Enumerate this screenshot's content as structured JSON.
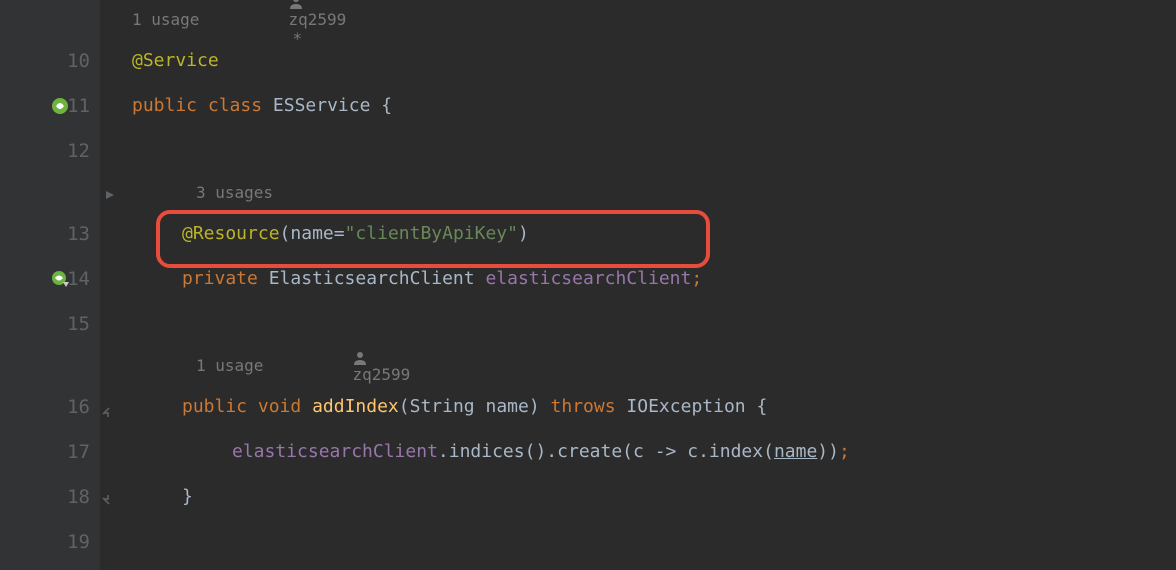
{
  "lines": {
    "l9": {
      "usages": "1 usage",
      "author": "zq2599",
      "star": "*"
    },
    "l10": {
      "annotation": "@Service"
    },
    "l11": {
      "public": "public",
      "class": "class",
      "name": "ESService",
      "brace": "{"
    },
    "l12_gap": {
      "usages": "3 usages"
    },
    "l13": {
      "annotation": "@Resource",
      "lparen": "(",
      "attr": "name",
      "eq": "=",
      "string": "\"clientByApiKey\"",
      "rparen": ")"
    },
    "l14": {
      "private": "private",
      "type": "ElasticsearchClient",
      "var": "elasticsearchClient",
      "semi": ";"
    },
    "l15_gap": {
      "usages": "1 usage",
      "author": "zq2599"
    },
    "l16": {
      "public": "public",
      "void": "void",
      "method": "addIndex",
      "lparen": "(",
      "ptype": "String",
      "pname": "name",
      "rparen": ")",
      "throws": "throws",
      "exc": "IOException",
      "brace": "{"
    },
    "l17": {
      "var": "elasticsearchClient",
      "dot1": ".",
      "m1": "indices",
      "p1": "()",
      "dot2": ".",
      "m2": "create",
      "lparen": "(",
      "lambda_p": "c",
      "arrow": " -> ",
      "lambda_v": "c",
      "dot3": ".",
      "m3": "index",
      "lparen2": "(",
      "arg": "name",
      "rparen2": ")",
      "rparen": ")",
      "semi": ";"
    },
    "l18": {
      "brace": "}"
    }
  },
  "numbers": {
    "n10": "10",
    "n11": "11",
    "n12": "12",
    "n13": "13",
    "n14": "14",
    "n15": "15",
    "n16": "16",
    "n17": "17",
    "n18": "18",
    "n19": "19"
  }
}
